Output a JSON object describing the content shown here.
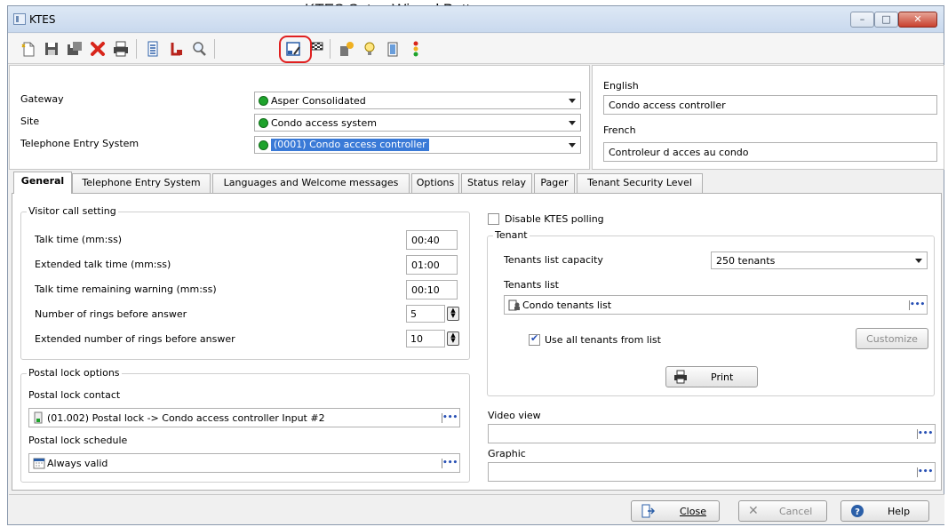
{
  "annotation": "KTES Setup Wizard Button",
  "window": {
    "title": "KTES",
    "min": "–",
    "max": "□",
    "close": "✕"
  },
  "accent_colors": {
    "highlight": "#e02020",
    "selection": "#3a7ad7",
    "status_green": "#1ea32c"
  },
  "toolbar": {
    "icons": [
      "new-icon",
      "save-icon",
      "save-copy-icon",
      "delete-icon",
      "print-icon",
      "list-icon",
      "link-icon",
      "search-icon",
      "setup-wizard-icon",
      "finish-flag-icon",
      "properties-icon",
      "lightbulb-icon",
      "door-icon",
      "status-light-icon"
    ]
  },
  "header": {
    "gateway_label": "Gateway",
    "gateway_value": "Asper Consolidated",
    "site_label": "Site",
    "site_value": "Condo access system",
    "tes_label": "Telephone Entry System",
    "tes_value": "(0001) Condo access controller",
    "english_label": "English",
    "english_value": "Condo access controller",
    "french_label": "French",
    "french_value": "Controleur d acces au condo"
  },
  "tabs": [
    "General",
    "Telephone Entry System",
    "Languages and Welcome messages",
    "Options",
    "Status relay",
    "Pager",
    "Tenant Security Level"
  ],
  "general": {
    "visitor_group": "Visitor call setting",
    "talk_time_label": "Talk time (mm:ss)",
    "talk_time": "00:40",
    "ext_talk_time_label": "Extended talk time (mm:ss)",
    "ext_talk_time": "01:00",
    "warning_label": "Talk time remaining warning (mm:ss)",
    "warning": "00:10",
    "rings_label": "Number of rings before answer",
    "rings": "5",
    "ext_rings_label": "Extended number of rings before answer",
    "ext_rings": "10",
    "postal_group": "Postal lock options",
    "postal_contact_label": "Postal lock contact",
    "postal_contact": "(01.002) Postal lock -> Condo access controller Input #2",
    "postal_schedule_label": "Postal lock schedule",
    "postal_schedule": "Always valid",
    "disable_polling_label": "Disable KTES polling",
    "disable_polling_checked": false,
    "tenant_group": "Tenant",
    "capacity_label": "Tenants list capacity",
    "capacity": "250 tenants",
    "tenants_list_label": "Tenants list",
    "tenants_list": "Condo tenants list",
    "use_all_label": "Use all tenants from list",
    "use_all_checked": true,
    "customize_label": "Customize",
    "print_label": "Print",
    "video_label": "Video view",
    "video_value": "",
    "graphic_label": "Graphic",
    "graphic_value": ""
  },
  "footer": {
    "close_label": "Close",
    "cancel_label": "Cancel",
    "help_label": "Help"
  }
}
